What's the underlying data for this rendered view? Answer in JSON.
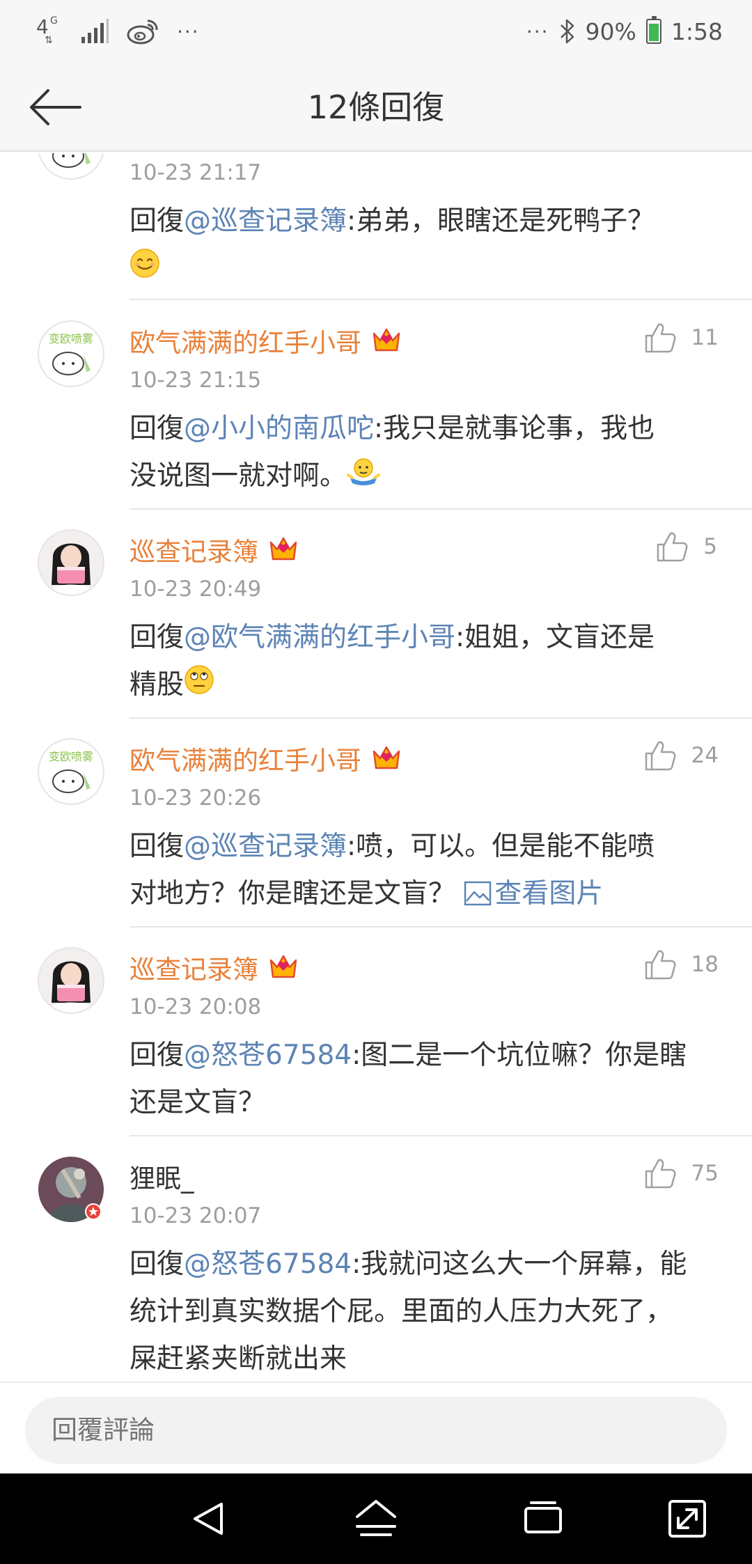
{
  "status_bar": {
    "network": "4G",
    "more": "···",
    "right_more": "···",
    "battery": "90%",
    "battery_level": 0.9,
    "time": "1:58"
  },
  "header": {
    "title": "12條回復"
  },
  "comments": [
    {
      "time": "10-23 21:17",
      "reply_prefix": "回復",
      "mention": "@巡查记录簿",
      "text_line1": ":弟弟，眼瞎还是死鸭子？",
      "emoji": "smile-emoji"
    },
    {
      "author": "欧气满满的红手小哥",
      "likes": "11",
      "time": "10-23 21:15",
      "reply_prefix": "回復",
      "mention": "@小小的南瓜咜",
      "text_line1": ":我只是就事论事，我也",
      "text_line2": "没说图一就对啊。",
      "emoji": "shrug-emoji"
    },
    {
      "author": "巡查记录簿",
      "likes": "5",
      "time": "10-23 20:49",
      "reply_prefix": "回復",
      "mention": "@欧气满满的红手小哥",
      "text_line1": ":姐姐，文盲还是",
      "text_line2": "精股",
      "emoji": "rolling-eyes-emoji"
    },
    {
      "author": "欧气满满的红手小哥",
      "likes": "24",
      "time": "10-23 20:26",
      "reply_prefix": "回復",
      "mention": "@巡查记录簿",
      "text_line1": ":喷，可以。但是能不能喷",
      "text_line2": "对地方？你是瞎还是文盲？",
      "view_image": "查看图片"
    },
    {
      "author": "巡查记录簿",
      "likes": "18",
      "time": "10-23 20:08",
      "reply_prefix": "回復",
      "mention": "@怒苍67584",
      "text_line1": ":图二是一个坑位嘛？你是瞎",
      "text_line2": "还是文盲？"
    },
    {
      "author": "狸眠_",
      "likes": "75",
      "time": "10-23 20:07",
      "reply_prefix": "回復",
      "mention": "@怒苍67584",
      "text_line1": ":我就问这么大一个屏幕，能",
      "text_line2": "统计到真实数据个屁。里面的人压力大死了，",
      "text_line3": "屎赶紧夹断就出来"
    }
  ],
  "avatar_text": "变欧喷雾",
  "reply_bar": {
    "placeholder": "回覆評論"
  },
  "colors": {
    "author": "#e8813a",
    "mention": "#5d84b5",
    "meta": "#9e9e9e"
  }
}
